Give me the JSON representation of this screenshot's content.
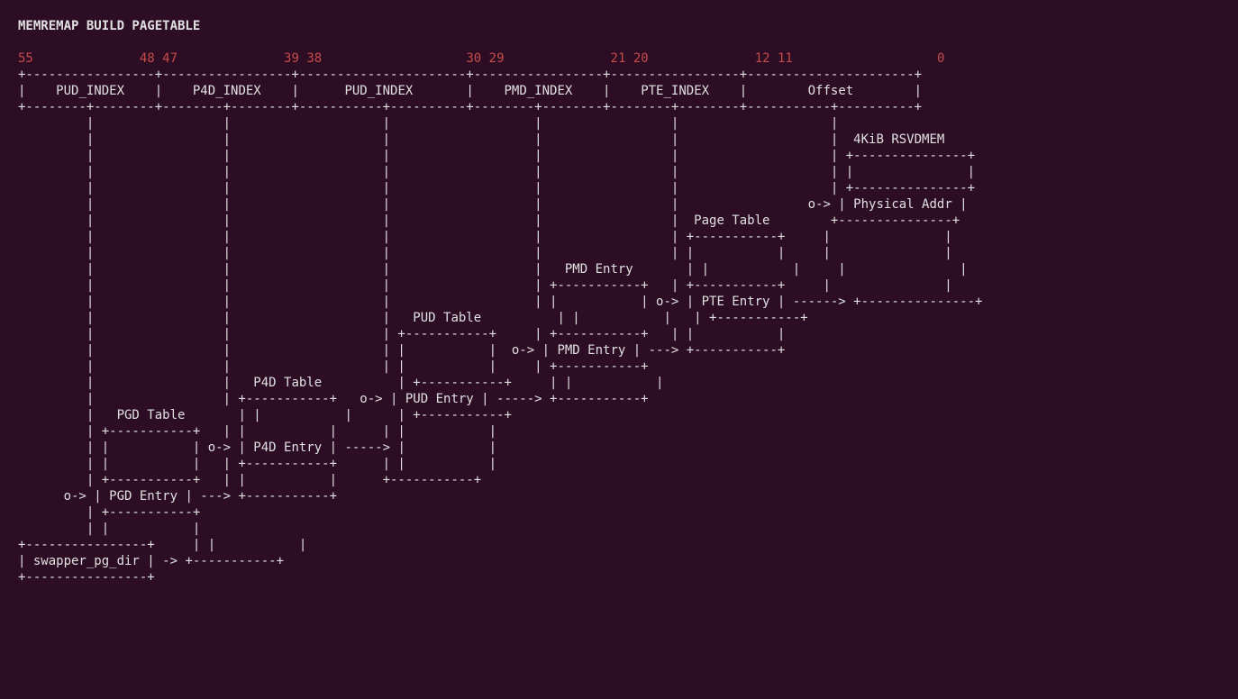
{
  "title": "MEMREMAP BUILD PAGETABLE",
  "bits": {
    "a": "55",
    "b": "48",
    "c": "47",
    "d": "39",
    "e": "38",
    "f": "30",
    "g": "29",
    "h": "21",
    "i": "20",
    "j": "12",
    "k": "11",
    "l": "0"
  },
  "fields": {
    "f1": "PUD_INDEX",
    "f2": "P4D_INDEX",
    "f3": "PUD_INDEX",
    "f4": "PMD_INDEX",
    "f5": "PTE_INDEX",
    "f6": "Offset"
  },
  "labels": {
    "rsvdmem": "4KiB RSVDMEM",
    "physaddr": "Physical Addr",
    "pagetable": "Page Table",
    "pmdentry_lbl": "PMD Entry",
    "pudtable": "PUD Table",
    "pteentry": "PTE Entry",
    "pmdentry": "PMD Entry",
    "p4dtable": "P4D Table",
    "pudentry": "PUD Entry",
    "pgdtable": "PGD Table",
    "p4dentry": "P4D Entry",
    "pgdentry": "PGD Entry",
    "swapper": "swapper_pg_dir"
  }
}
